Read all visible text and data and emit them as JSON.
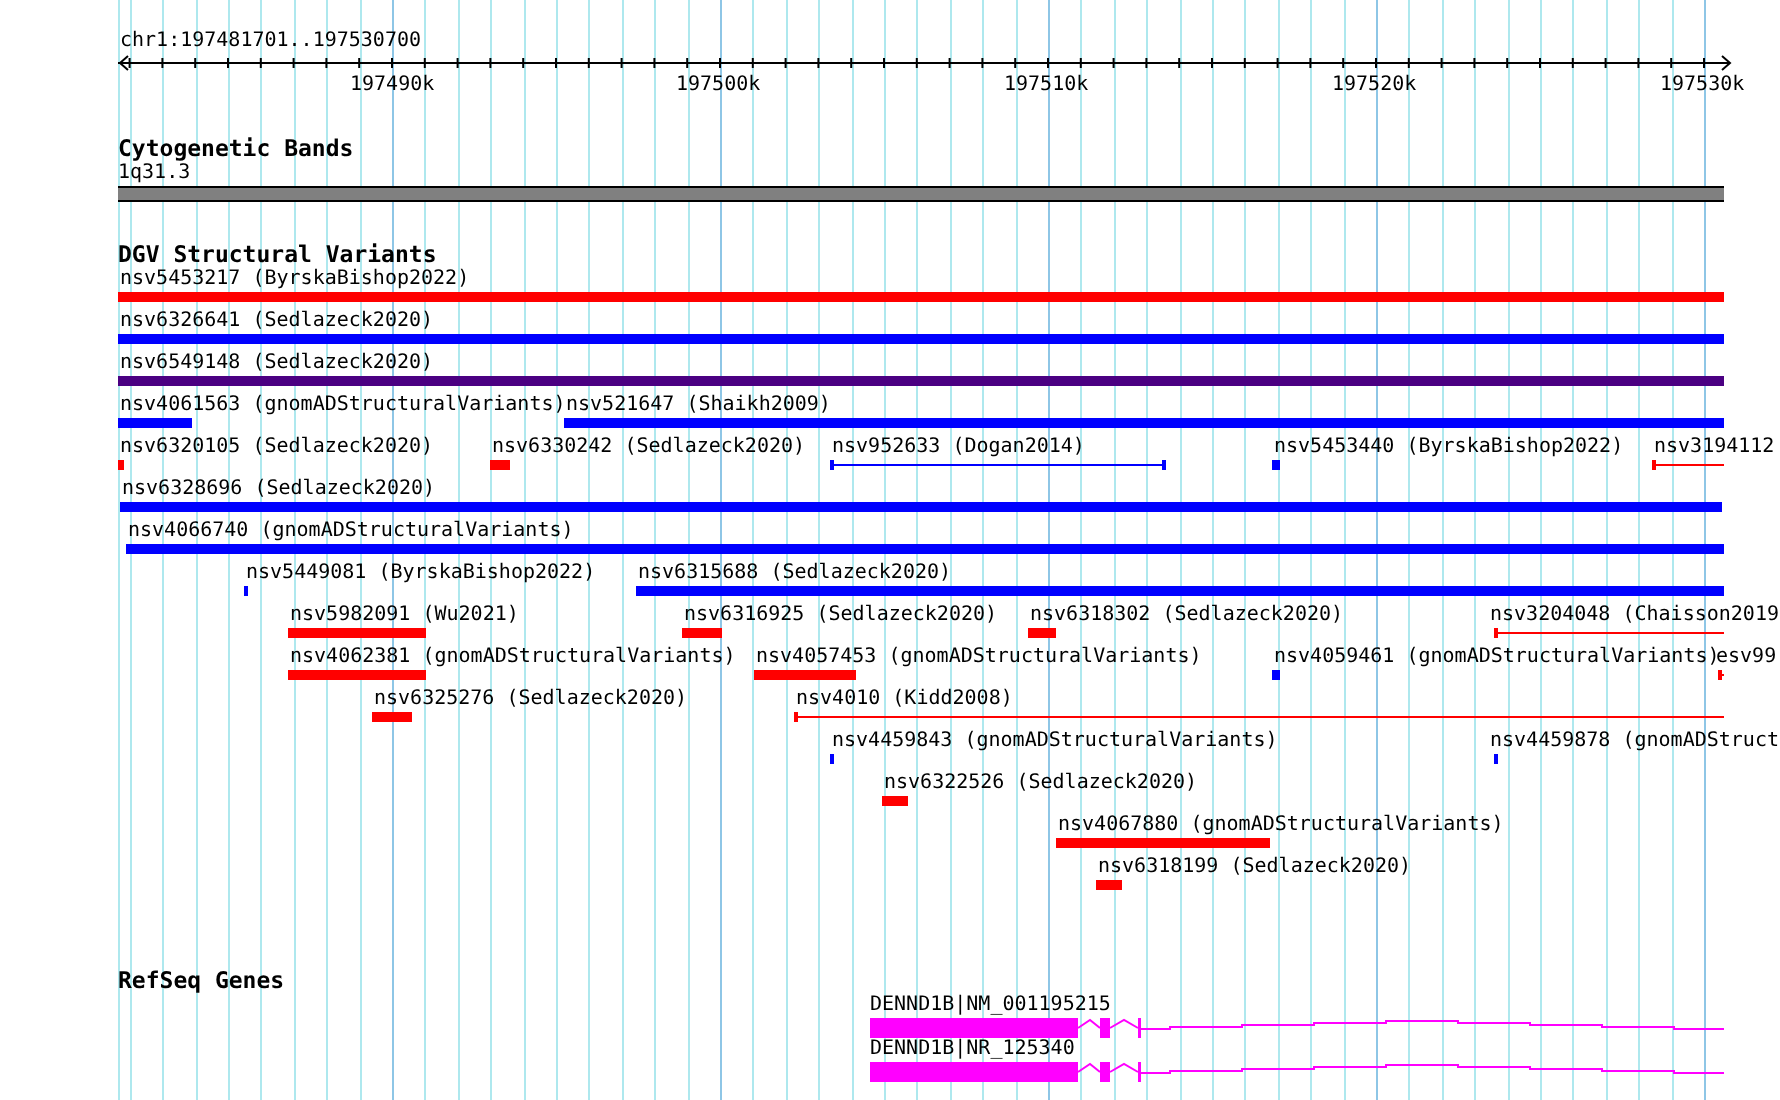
{
  "ruler": {
    "location": "chr1:197481701..197530700",
    "ticks": [
      "197490k",
      "197500k",
      "197510k",
      "197520k",
      "197530k"
    ]
  },
  "tracks": [
    {
      "kind": "bands",
      "title": "Cytogenetic Bands",
      "features": [
        {
          "label": "1q31.3"
        }
      ]
    },
    {
      "kind": "variants",
      "title": "DGV Structural Variants",
      "rows": [
        {
          "features": [
            {
              "label": "nsv5453217 (ByrskaBishop2022)",
              "color": "#ff0000",
              "kind": "block"
            }
          ]
        },
        {
          "features": [
            {
              "label": "nsv6326641 (Sedlazeck2020)",
              "color": "#0000ff",
              "kind": "block"
            }
          ]
        },
        {
          "features": [
            {
              "label": "nsv6549148 (Sedlazeck2020)",
              "color": "#4b0082",
              "kind": "block"
            }
          ]
        },
        {
          "features": [
            {
              "label": "nsv4061563 (gnomADStructuralVariants)",
              "color": "#0000ff",
              "kind": "block"
            },
            {
              "label": "nsv521647 (Shaikh2009)",
              "color": "#0000ff",
              "kind": "block"
            }
          ]
        },
        {
          "features": [
            {
              "label": "nsv6320105 (Sedlazeck2020)",
              "color": "#ff0000",
              "kind": "block"
            },
            {
              "label": "nsv6330242 (Sedlazeck2020)",
              "color": "#ff0000",
              "kind": "block"
            },
            {
              "label": "nsv952633 (Dogan2014)",
              "color": "#0000ff",
              "kind": "span"
            },
            {
              "label": "nsv5453440 (ByrskaBishop2022)",
              "color": "#0000ff",
              "kind": "block"
            },
            {
              "label": "nsv3194112",
              "color": "#ff0000",
              "kind": "span"
            }
          ]
        },
        {
          "features": [
            {
              "label": "nsv6328696 (Sedlazeck2020)",
              "color": "#0000ff",
              "kind": "block"
            }
          ]
        },
        {
          "features": [
            {
              "label": "nsv4066740 (gnomADStructuralVariants)",
              "color": "#0000ff",
              "kind": "block"
            }
          ]
        },
        {
          "features": [
            {
              "label": "nsv5449081 (ByrskaBishop2022)",
              "color": "#0000ff",
              "kind": "block"
            },
            {
              "label": "nsv6315688 (Sedlazeck2020)",
              "color": "#0000ff",
              "kind": "block"
            }
          ]
        },
        {
          "features": [
            {
              "label": "nsv5982091 (Wu2021)",
              "color": "#ff0000",
              "kind": "block"
            },
            {
              "label": "nsv6316925 (Sedlazeck2020)",
              "color": "#ff0000",
              "kind": "block"
            },
            {
              "label": "nsv6318302 (Sedlazeck2020)",
              "color": "#ff0000",
              "kind": "block"
            },
            {
              "label": "nsv3204048 (Chaisson2019",
              "color": "#ff0000",
              "kind": "span"
            }
          ]
        },
        {
          "features": [
            {
              "label": "nsv4062381 (gnomADStructuralVariants)",
              "color": "#ff0000",
              "kind": "block"
            },
            {
              "label": "nsv4057453 (gnomADStructuralVariants)",
              "color": "#ff0000",
              "kind": "block"
            },
            {
              "label": "nsv4059461 (gnomADStructuralVariants)",
              "color": "#0000ff",
              "kind": "block"
            },
            {
              "label": "esv99",
              "color": "#ff0000",
              "kind": "span"
            }
          ]
        },
        {
          "features": [
            {
              "label": "nsv6325276 (Sedlazeck2020)",
              "color": "#ff0000",
              "kind": "block"
            },
            {
              "label": "nsv4010 (Kidd2008)",
              "color": "#ff0000",
              "kind": "span"
            }
          ]
        },
        {
          "features": [
            {
              "label": "nsv4459843 (gnomADStructuralVariants)",
              "color": "#0000ff",
              "kind": "block"
            },
            {
              "label": "nsv4459878 (gnomADStruct",
              "color": "#0000ff",
              "kind": "block"
            }
          ]
        },
        {
          "features": [
            {
              "label": "nsv6322526 (Sedlazeck2020)",
              "color": "#ff0000",
              "kind": "block"
            }
          ]
        },
        {
          "features": [
            {
              "label": "nsv4067880 (gnomADStructuralVariants)",
              "color": "#ff0000",
              "kind": "block"
            }
          ]
        },
        {
          "features": [
            {
              "label": "nsv6318199 (Sedlazeck2020)",
              "color": "#ff0000",
              "kind": "block"
            }
          ]
        }
      ]
    },
    {
      "kind": "genes",
      "title": "RefSeq Genes",
      "features": [
        {
          "label": "DENND1B|NM_001195215"
        },
        {
          "label": "DENND1B|NR_125340"
        }
      ]
    }
  ]
}
